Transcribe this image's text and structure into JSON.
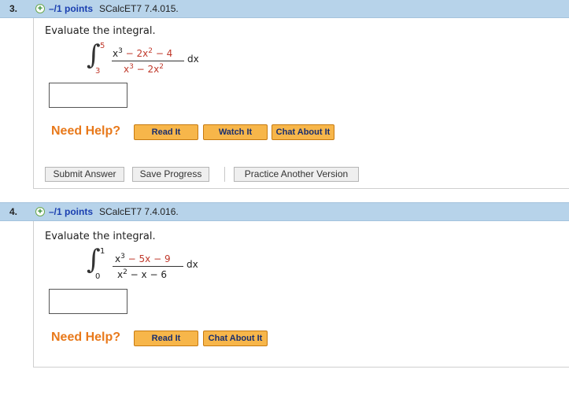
{
  "questions": [
    {
      "number": "3.",
      "points": "–/1 points",
      "source": "SCalcET7 7.4.015.",
      "prompt": "Evaluate the integral.",
      "integral": {
        "upper": "5",
        "lower": "3",
        "num_a": "x",
        "num_a_exp": "3",
        "num_b": " − 2x",
        "num_b_exp": "2",
        "num_c": " − 4",
        "den_a": "x",
        "den_a_exp": "3",
        "den_b": " − 2x",
        "den_b_exp": "2",
        "dx": "dx"
      },
      "need_help": "Need Help?",
      "help_buttons": [
        "Read It",
        "Watch It",
        "Chat About It"
      ],
      "submit_label": "Submit Answer",
      "save_label": "Save Progress",
      "practice_label": "Practice Another Version"
    },
    {
      "number": "4.",
      "points": "–/1 points",
      "source": "SCalcET7 7.4.016.",
      "prompt": "Evaluate the integral.",
      "integral": {
        "upper": "1",
        "lower": "0",
        "num_a": "x",
        "num_a_exp": "3",
        "num_b": " − 5x",
        "num_c": " − 9",
        "den_a": "x",
        "den_a_exp": "2",
        "den_b": " − x − 6",
        "dx": "dx"
      },
      "need_help": "Need Help?",
      "help_buttons": [
        "Read It",
        "Chat About It"
      ]
    }
  ],
  "colors": {
    "header_bg": "#b7d3ea",
    "points_text": "#1a3fb0",
    "need_help": "#e8791b",
    "help_button": "#f7b64a",
    "math_highlight": "#c0392b"
  },
  "icons": {
    "expand": "plus-circle-icon"
  }
}
